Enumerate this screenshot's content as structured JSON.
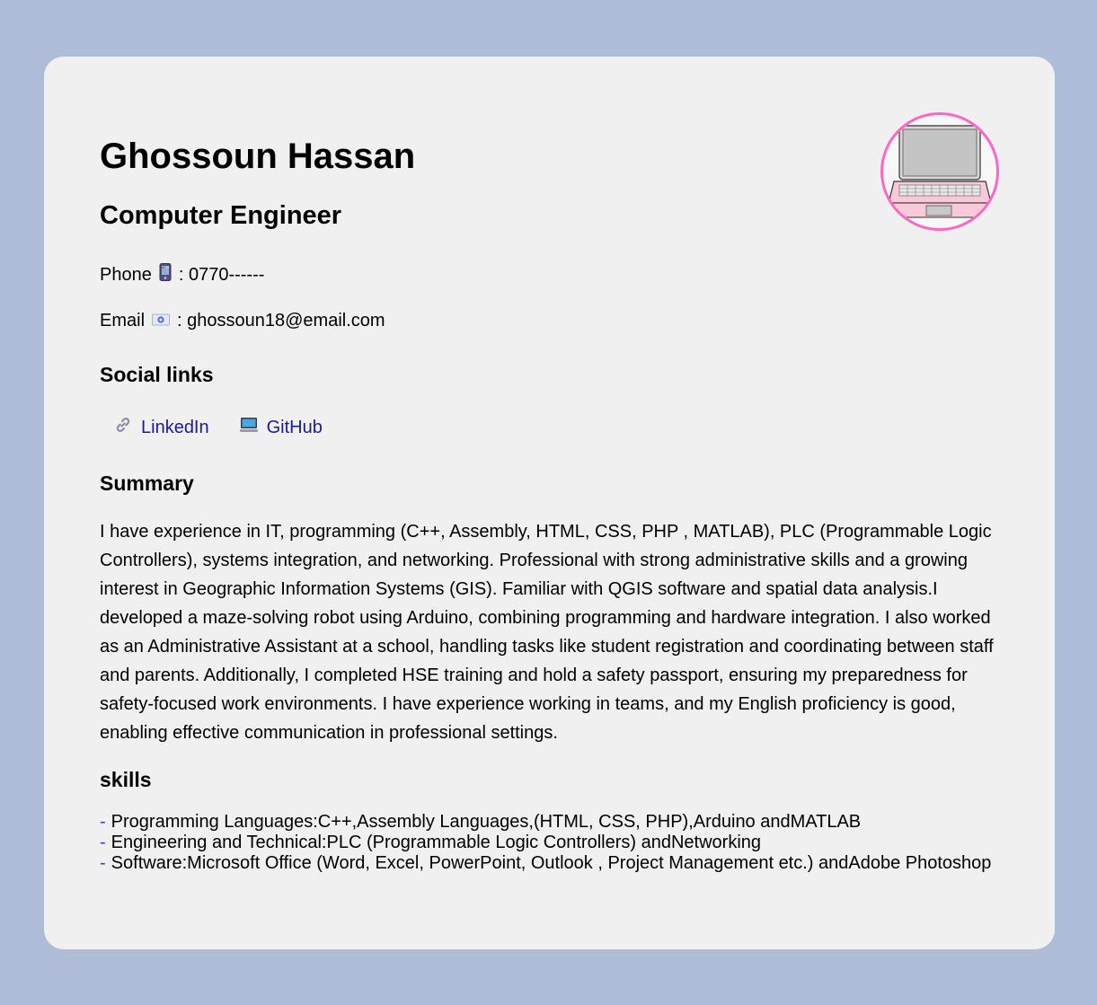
{
  "header": {
    "name": "Ghossoun Hassan",
    "title": "Computer Engineer",
    "avatar_icon": "laptop-icon"
  },
  "contact": {
    "phone_label": "Phone",
    "phone_icon": "mobile-phone-icon",
    "phone_value": ": 0770------",
    "email_label": "Email",
    "email_icon": "email-icon",
    "email_value": ": ghossoun18@email.com"
  },
  "social": {
    "heading": "Social links",
    "links": [
      {
        "label": "LinkedIn",
        "icon": "link-icon"
      },
      {
        "label": "GitHub",
        "icon": "computer-icon"
      }
    ]
  },
  "summary": {
    "heading": "Summary",
    "text": "I have experience in IT, programming (C++, Assembly, HTML, CSS, PHP , MATLAB), PLC (Programmable Logic Controllers), systems integration, and networking. Professional with strong administrative skills and a growing interest in Geographic Information Systems (GIS). Familiar with QGIS software and spatial data analysis.I developed a maze-solving robot using Arduino, combining programming and hardware integration. I also worked as an Administrative Assistant at a school, handling tasks like student registration and coordinating between staff and parents. Additionally, I completed HSE training and hold a safety passport, ensuring my preparedness for safety-focused work environments. I have experience working in teams, and my English proficiency is good, enabling effective communication in professional settings."
  },
  "skills": {
    "heading": "skills",
    "bullet": "-",
    "items": [
      "Programming Languages:C++,Assembly Languages,(HTML, CSS, PHP),Arduino andMATLAB",
      "Engineering and Technical:PLC (Programmable Logic Controllers) andNetworking",
      "Software:Microsoft Office (Word, Excel, PowerPoint, Outlook , Project Management etc.) andAdobe Photoshop"
    ]
  },
  "colors": {
    "background": "#aebcd8",
    "card": "#f0f0f0",
    "link": "#1a1a9e",
    "avatar_border": "#ff66c4"
  }
}
